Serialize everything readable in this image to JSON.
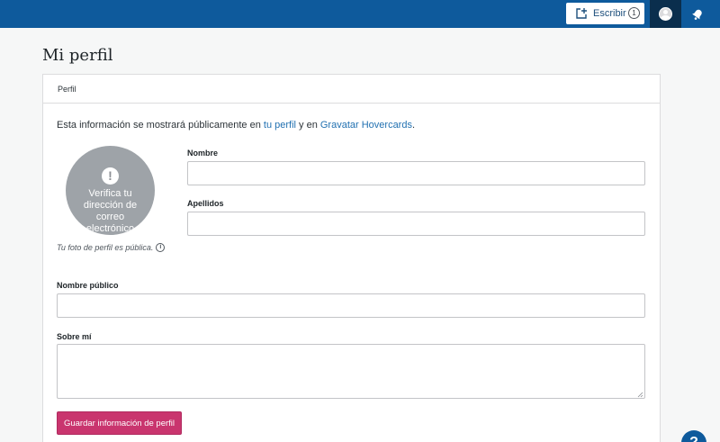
{
  "topbar": {
    "write_label": "Escribir",
    "write_count": "1",
    "colors": {
      "bar": "#0e5a9c",
      "active": "#0a2e4d"
    }
  },
  "page": {
    "title": "Mi perfil"
  },
  "card": {
    "header": "Perfil",
    "intro": {
      "before": "Esta información se mostrará públicamente en ",
      "profile_link": "tu perfil",
      "middle": " y en ",
      "hovercards_link": "Gravatar Hovercards",
      "after": "."
    },
    "photo": {
      "alert_icon": "!",
      "text": "Verifica tu dirección de correo electrónico",
      "note": "Tu foto de perfil es pública.",
      "info_icon": "i"
    },
    "fields": {
      "first_name": {
        "label": "Nombre",
        "value": ""
      },
      "last_name": {
        "label": "Apellidos",
        "value": ""
      },
      "display_name": {
        "label": "Nombre público",
        "value": ""
      },
      "about": {
        "label": "Sobre mí",
        "value": ""
      }
    },
    "save_label": "Guardar información de perfil"
  },
  "help": {
    "label": "?"
  },
  "colors": {
    "accent": "#c9356e",
    "link": "#2271b1"
  }
}
